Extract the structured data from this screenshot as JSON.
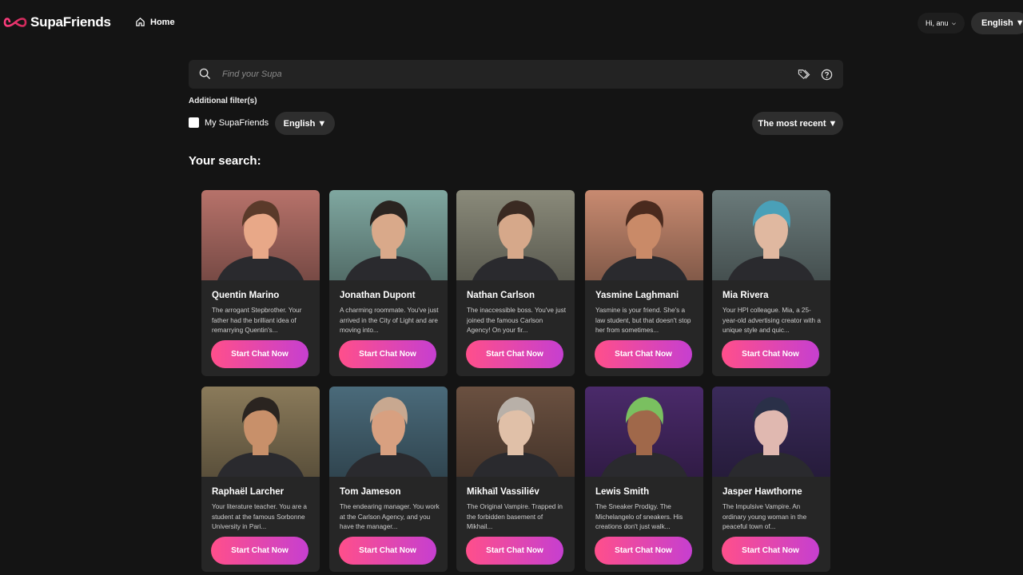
{
  "header": {
    "logo_text": "SupaFriends",
    "home_label": "Home",
    "greeting": "Hi, anu",
    "language": "English ▼"
  },
  "search": {
    "placeholder": "Find your Supa"
  },
  "filters": {
    "additional_label": "Additional filter(s)",
    "my_supafriends_label": "My SupaFriends",
    "my_supafriends_checked": false,
    "language": "English ▼",
    "sort": "The most recent ▼"
  },
  "results_heading": "Your search:",
  "cards": [
    {
      "name": "Quentin Marino",
      "description": "The arrogant Stepbrother. Your father had the brilliant idea of remarrying Quentin's...",
      "button": "Start Chat Now",
      "palette": [
        "#b7726a",
        "#e8a888",
        "#5a3a2a"
      ]
    },
    {
      "name": "Jonathan Dupont",
      "description": "A charming roommate. You've just arrived in the City of Light and are moving into...",
      "button": "Start Chat Now",
      "palette": [
        "#7fa7a0",
        "#d9a98a",
        "#2a2420"
      ]
    },
    {
      "name": "Nathan Carlson",
      "description": "The inaccessible boss. You've just joined the famous Carlson Agency! On your fir...",
      "button": "Start Chat Now",
      "palette": [
        "#8a8a7a",
        "#d6a88a",
        "#3a2a22"
      ]
    },
    {
      "name": "Yasmine Laghmani",
      "description": "Yasmine is your friend. She's a law student, but that doesn't stop her from sometimes...",
      "button": "Start Chat Now",
      "palette": [
        "#c88a70",
        "#c98a68",
        "#4a2a1e"
      ]
    },
    {
      "name": "Mia Rivera",
      "description": "Your HPI colleague. Mia, a 25-year-old advertising creator with a unique style and quic...",
      "button": "Start Chat Now",
      "palette": [
        "#6a7a7a",
        "#e0b8a0",
        "#4aa0b8"
      ]
    },
    {
      "name": "Raphaël Larcher",
      "description": "Your literature teacher. You are a student at the famous Sorbonne University in Pari...",
      "button": "Start Chat Now",
      "palette": [
        "#8a7a5a",
        "#c8906a",
        "#2a2420"
      ]
    },
    {
      "name": "Tom Jameson",
      "description": "The endearing manager. You work at the Carlson Agency, and you have the manager...",
      "button": "Start Chat Now",
      "palette": [
        "#4a6a7a",
        "#d8a080",
        "#c8a890"
      ]
    },
    {
      "name": "Mikhaïl Vassiliév",
      "description": "The Original Vampire. Trapped in the forbidden basement of Mikhail...",
      "button": "Start Chat Now",
      "palette": [
        "#6a5040",
        "#e0c0a8",
        "#b8b0a8"
      ]
    },
    {
      "name": "Lewis Smith",
      "description": "The Sneaker Prodigy. The Michelangelo of sneakers. His creations don't just walk...",
      "button": "Start Chat Now",
      "palette": [
        "#4a2a6a",
        "#a0684a",
        "#7ac060"
      ]
    },
    {
      "name": "Jasper Hawthorne",
      "description": "The Impulsive Vampire. An ordinary young woman in the peaceful town of...",
      "button": "Start Chat Now",
      "palette": [
        "#3a2a5a",
        "#e0b8b0",
        "#2a3048"
      ]
    }
  ],
  "colors": {
    "background": "#141414",
    "card": "#262626",
    "button_gradient_start": "#ff4f8b",
    "button_gradient_end": "#c63fd0"
  }
}
